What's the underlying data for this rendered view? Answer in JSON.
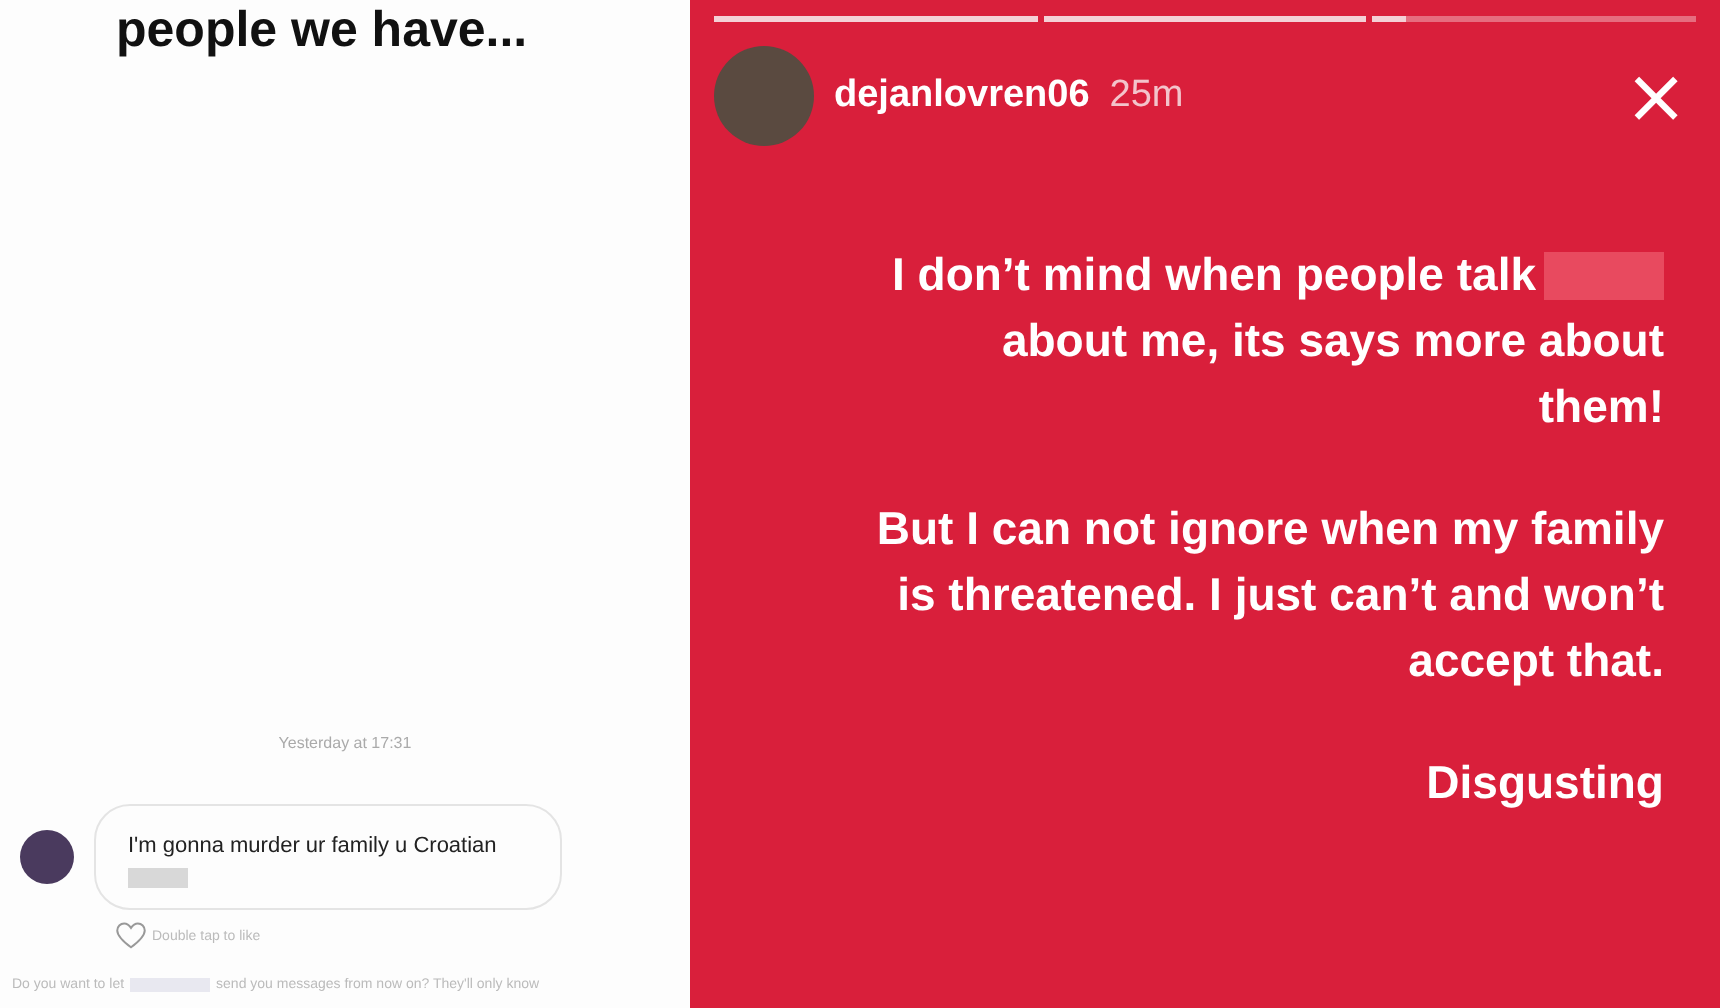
{
  "chat": {
    "caption": "people we have...",
    "timestamp": "Yesterday at 17:31",
    "message": {
      "text": "I'm gonna murder ur family u Croatian",
      "redacted": true
    },
    "like_hint": "Double tap to like",
    "request_notice": {
      "before": "Do you want to let",
      "after": "send you messages from now on? They'll only know"
    }
  },
  "story": {
    "progress": [
      {
        "level": 1
      },
      {
        "level": 1
      },
      {
        "level": 0.1
      }
    ],
    "username": "dejanlovren06",
    "time": "25m",
    "close": "×",
    "paragraphs": [
      {
        "lines": [
          "I don’t mind when people talk",
          "about me, its says more about",
          "them!"
        ],
        "redacted": true
      },
      {
        "lines": [
          "But I can not ignore when my family",
          "is threatened. I just can’t and won’t",
          "accept that."
        ],
        "redacted": false
      },
      {
        "lines": [
          "Disgusting"
        ],
        "redacted": false
      }
    ]
  }
}
